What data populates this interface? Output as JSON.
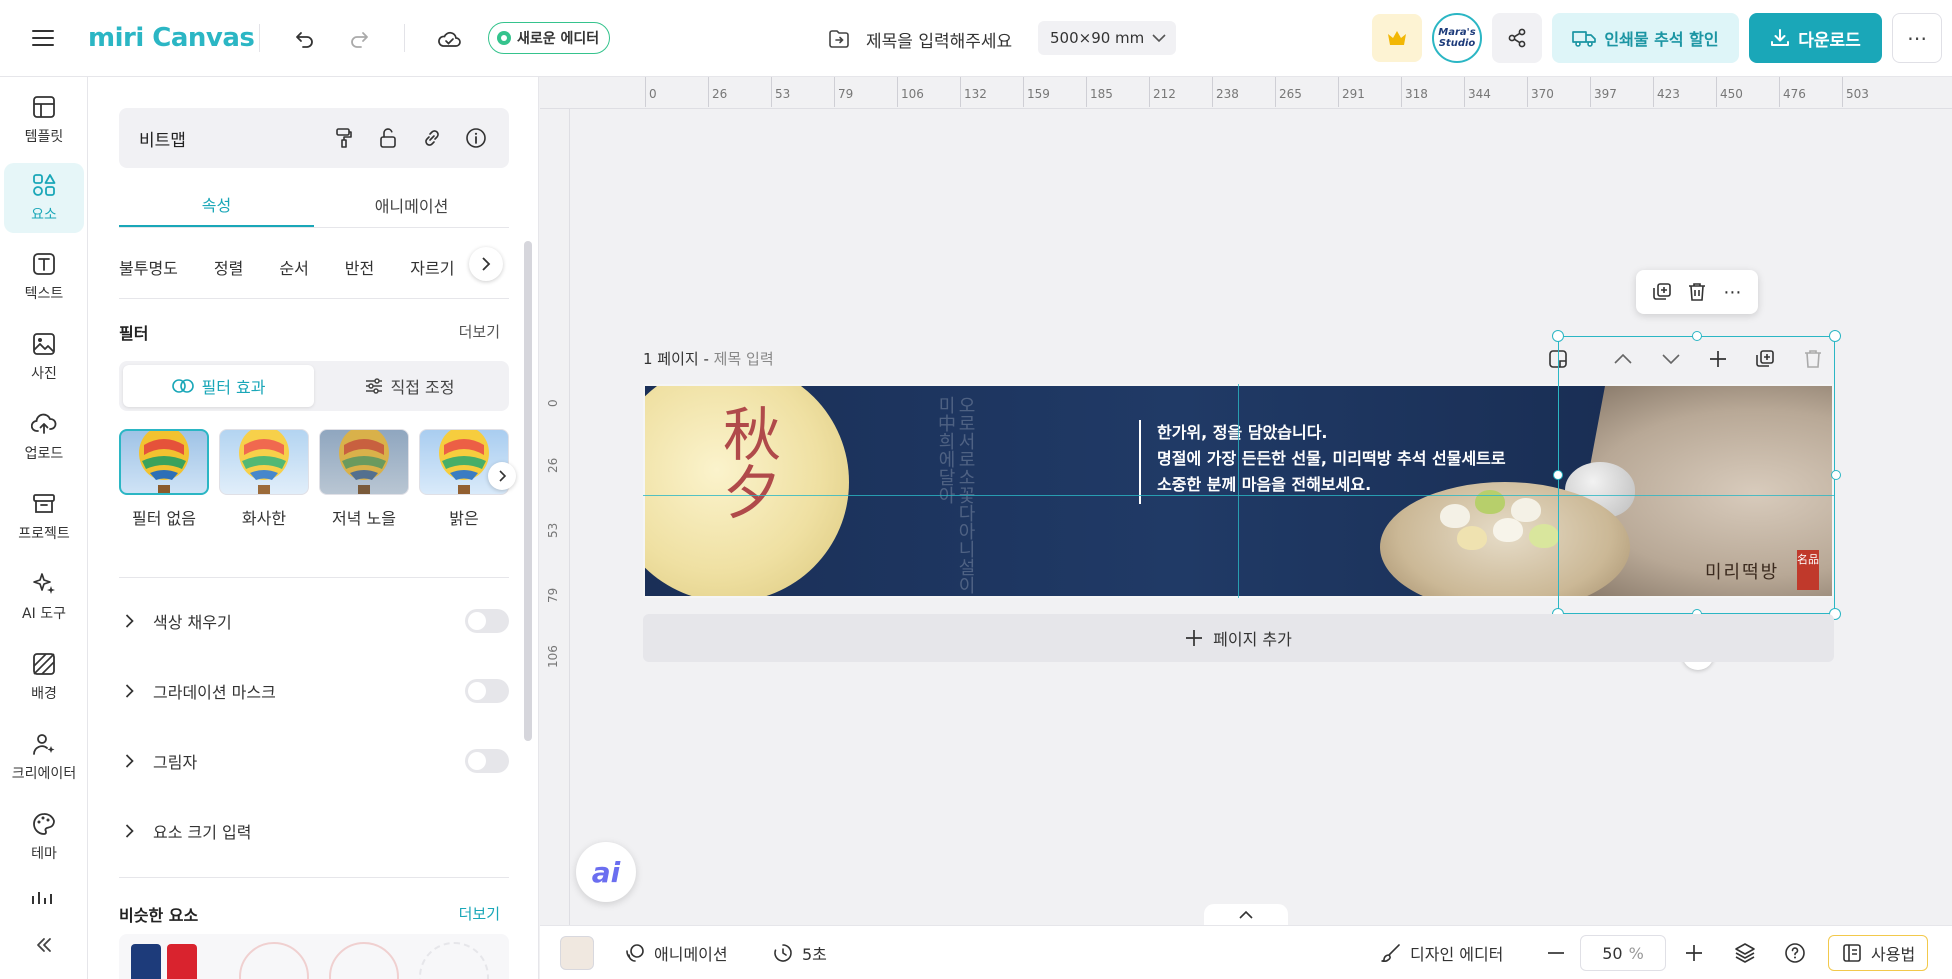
{
  "topbar": {
    "logo": "miri Canvas",
    "new_editor_label": "새로운 에디터",
    "doc_title_placeholder": "제목을 입력해주세요",
    "size_label": "500×90 mm",
    "avatar_line1": "Mara's",
    "avatar_line2": "Studio",
    "print_sale_label": "인쇄물 추석 할인",
    "download_label": "다운로드"
  },
  "rail": {
    "items": [
      {
        "label": "템플릿",
        "icon": "template-icon"
      },
      {
        "label": "요소",
        "icon": "elements-icon",
        "active": true
      },
      {
        "label": "텍스트",
        "icon": "text-icon"
      },
      {
        "label": "사진",
        "icon": "photo-icon"
      },
      {
        "label": "업로드",
        "icon": "upload-icon"
      },
      {
        "label": "프로젝트",
        "icon": "project-icon"
      },
      {
        "label": "AI 도구",
        "icon": "ai-tools-icon"
      },
      {
        "label": "배경",
        "icon": "background-icon"
      },
      {
        "label": "크리에이터",
        "icon": "creator-icon"
      },
      {
        "label": "테마",
        "icon": "theme-icon"
      }
    ]
  },
  "panel": {
    "element_name": "비트맵",
    "tabs": [
      "속성",
      "애니메이션"
    ],
    "subtabs": [
      "불투명도",
      "정렬",
      "순서",
      "반전",
      "자르기"
    ],
    "filter_title": "필터",
    "more": "더보기",
    "filter_modes": [
      "필터 효과",
      "직접 조정"
    ],
    "filters": [
      "필터 없음",
      "화사한",
      "저녁 노을",
      "밝은"
    ],
    "toggles": [
      "색상 채우기",
      "그라데이션 마스크",
      "그림자"
    ],
    "size_input": "요소 크기 입력",
    "similar_title": "비슷한 요소",
    "similar_more": "더보기"
  },
  "canvas": {
    "ruler_top": [
      "0",
      "26",
      "53",
      "79",
      "106",
      "132",
      "159",
      "185",
      "212",
      "238",
      "265",
      "291",
      "318",
      "344",
      "370",
      "397",
      "423",
      "450",
      "476",
      "503"
    ],
    "ruler_left": [
      "0",
      "26",
      "53",
      "79",
      "106"
    ],
    "page_label": "1 페이지 - ",
    "page_title_placeholder": "제목 입력",
    "banner": {
      "hanja": "秋夕",
      "calligraphy": "오로서로소꽃다아니설이 미中희에달아",
      "line1": "한가위, 정을 담았습니다.",
      "line2": "명절에 가장 든든한 선물, 미리떡방 추석 선물세트로",
      "line3": "소중한 분께 마음을 전해보세요.",
      "brand": "미리떡방",
      "seal": "名品"
    },
    "add_page_label": "페이지 추가",
    "ai_label": "ai"
  },
  "bottombar": {
    "animation_label": "애니메이션",
    "duration_label": "5초",
    "design_editor_label": "디자인 에디터",
    "zoom_value": "50",
    "zoom_unit": "%",
    "usage_label": "사용법"
  },
  "colors": {
    "accent": "#1aa7b8",
    "accent_light": "#def5f8",
    "selection": "#2bb6c4"
  }
}
